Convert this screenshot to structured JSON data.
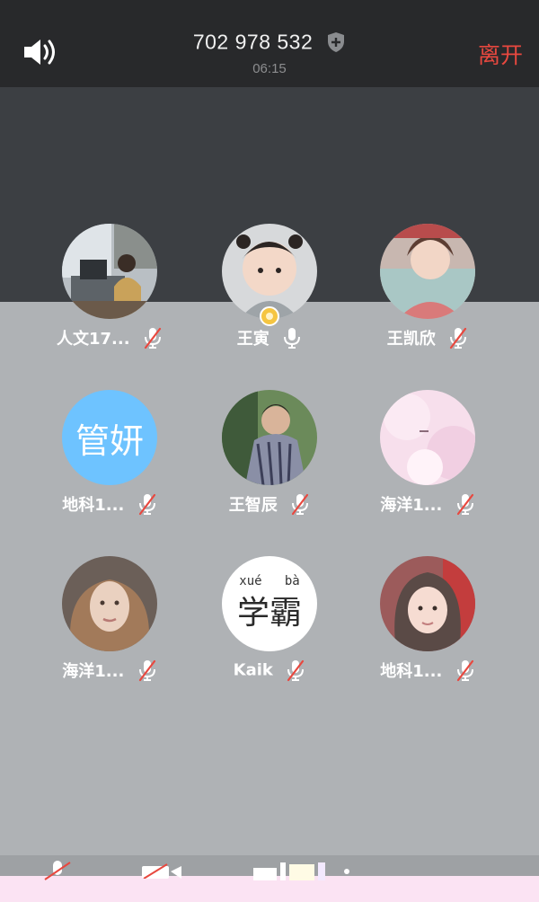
{
  "header": {
    "meeting_id": "702 978 532",
    "timer": "06:15",
    "leave_label": "离开"
  },
  "participants": [
    {
      "name": "人文17...",
      "mic": "muted"
    },
    {
      "name": "王寅",
      "mic": "on",
      "host": true
    },
    {
      "name": "王凯欣",
      "mic": "muted"
    },
    {
      "name": "地科1...",
      "mic": "muted",
      "avatar_text": "管妍",
      "avatar_color": "#6ec3ff"
    },
    {
      "name": "王智辰",
      "mic": "muted"
    },
    {
      "name": "海洋1...",
      "mic": "muted"
    },
    {
      "name": "海洋1...",
      "mic": "muted"
    },
    {
      "name": "Kaik",
      "mic": "muted",
      "avatar_text": "学霸",
      "avatar_pinyin": "xué   bà"
    },
    {
      "name": "地科1...",
      "mic": "muted"
    }
  ],
  "colors": {
    "topbar": "#28292b",
    "leave": "#e8483f",
    "muted_slash": "#e8483f"
  }
}
